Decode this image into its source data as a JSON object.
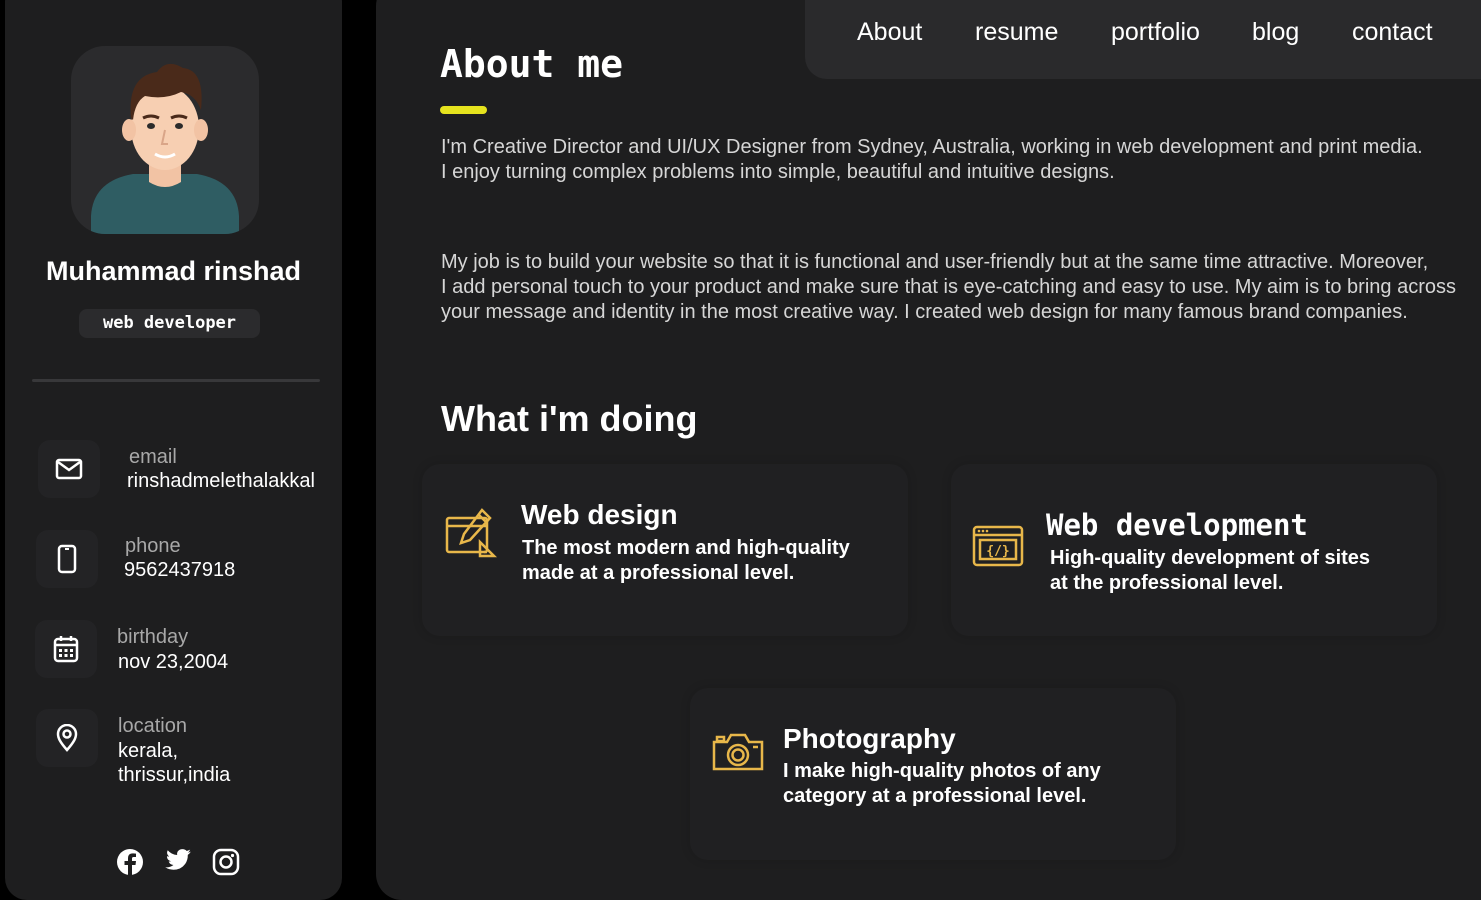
{
  "profile": {
    "name": "Muhammad rinshad",
    "role": "web developer"
  },
  "contacts": [
    {
      "label": "email",
      "value": "rinshadmelethalakkal",
      "icon": "mail-icon"
    },
    {
      "label": "phone",
      "value": "9562437918",
      "icon": "phone-icon"
    },
    {
      "label": "birthday",
      "value": "nov 23,2004",
      "icon": "calendar-icon"
    },
    {
      "label": "location",
      "value_line1": "kerala,",
      "value_line2": "thrissur,india",
      "icon": "location-pin-icon"
    }
  ],
  "socials": [
    "facebook-icon",
    "twitter-icon",
    "instagram-icon"
  ],
  "nav": [
    "About",
    "resume",
    "portfolio",
    "blog",
    "contact"
  ],
  "about": {
    "title": "About me",
    "p1_line1": "I'm Creative Director and UI/UX Designer from Sydney, Australia, working in web development and print media.",
    "p1_line2": "I enjoy turning complex problems into simple, beautiful and intuitive designs.",
    "p2_line1": "My job is to build your website so that it is functional and user-friendly but at the same time attractive. Moreover,",
    "p2_line2": "I add personal touch to your product and make sure that is eye-catching and easy to use. My aim is to bring across your message and identity in the most creative way. I created web design for many famous brand companies."
  },
  "services": {
    "title": "What i'm doing",
    "items": [
      {
        "title": "Web design",
        "text": "The most modern and high-quality made at a professional level.",
        "icon": "design-pencil-icon"
      },
      {
        "title": "Web development",
        "text": "High-quality development of sites at the professional level.",
        "icon": "code-window-icon"
      },
      {
        "title": "Photography",
        "text": "I make high-quality photos of any category at a professional level.",
        "icon": "camera-icon"
      }
    ]
  },
  "colors": {
    "accent": "#e6e31e",
    "icon_gold": "#e8b74a",
    "card_bg": "#202022",
    "panel_bg": "#1e1e1f"
  }
}
